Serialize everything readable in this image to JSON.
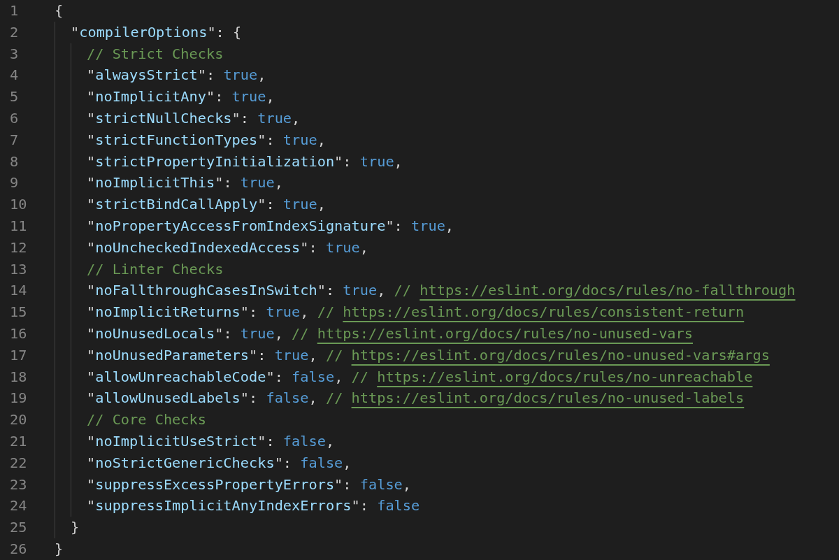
{
  "editor": {
    "lines": [
      {
        "number": "1",
        "tokens": [
          {
            "kind": "punct",
            "text": "{"
          }
        ],
        "children": [
          {
            "number": "2",
            "tokens": [
              {
                "kind": "key",
                "text": "\"compilerOptions\""
              },
              {
                "kind": "punct",
                "text": ": {"
              }
            ],
            "children": [
              {
                "number": "3",
                "tokens": [
                  {
                    "kind": "comment",
                    "text": "// Strict Checks"
                  }
                ]
              },
              {
                "number": "4",
                "tokens": [
                  {
                    "kind": "key",
                    "text": "\"alwaysStrict\""
                  },
                  {
                    "kind": "punct",
                    "text": ": "
                  },
                  {
                    "kind": "bool",
                    "text": "true"
                  },
                  {
                    "kind": "punct",
                    "text": ","
                  }
                ]
              },
              {
                "number": "5",
                "tokens": [
                  {
                    "kind": "key",
                    "text": "\"noImplicitAny\""
                  },
                  {
                    "kind": "punct",
                    "text": ": "
                  },
                  {
                    "kind": "bool",
                    "text": "true"
                  },
                  {
                    "kind": "punct",
                    "text": ","
                  }
                ]
              },
              {
                "number": "6",
                "tokens": [
                  {
                    "kind": "key",
                    "text": "\"strictNullChecks\""
                  },
                  {
                    "kind": "punct",
                    "text": ": "
                  },
                  {
                    "kind": "bool",
                    "text": "true"
                  },
                  {
                    "kind": "punct",
                    "text": ","
                  }
                ]
              },
              {
                "number": "7",
                "tokens": [
                  {
                    "kind": "key",
                    "text": "\"strictFunctionTypes\""
                  },
                  {
                    "kind": "punct",
                    "text": ": "
                  },
                  {
                    "kind": "bool",
                    "text": "true"
                  },
                  {
                    "kind": "punct",
                    "text": ","
                  }
                ]
              },
              {
                "number": "8",
                "tokens": [
                  {
                    "kind": "key",
                    "text": "\"strictPropertyInitialization\""
                  },
                  {
                    "kind": "punct",
                    "text": ": "
                  },
                  {
                    "kind": "bool",
                    "text": "true"
                  },
                  {
                    "kind": "punct",
                    "text": ","
                  }
                ]
              },
              {
                "number": "9",
                "tokens": [
                  {
                    "kind": "key",
                    "text": "\"noImplicitThis\""
                  },
                  {
                    "kind": "punct",
                    "text": ": "
                  },
                  {
                    "kind": "bool",
                    "text": "true"
                  },
                  {
                    "kind": "punct",
                    "text": ","
                  }
                ]
              },
              {
                "number": "10",
                "tokens": [
                  {
                    "kind": "key",
                    "text": "\"strictBindCallApply\""
                  },
                  {
                    "kind": "punct",
                    "text": ": "
                  },
                  {
                    "kind": "bool",
                    "text": "true"
                  },
                  {
                    "kind": "punct",
                    "text": ","
                  }
                ]
              },
              {
                "number": "11",
                "tokens": [
                  {
                    "kind": "key",
                    "text": "\"noPropertyAccessFromIndexSignature\""
                  },
                  {
                    "kind": "punct",
                    "text": ": "
                  },
                  {
                    "kind": "bool",
                    "text": "true"
                  },
                  {
                    "kind": "punct",
                    "text": ","
                  }
                ]
              },
              {
                "number": "12",
                "tokens": [
                  {
                    "kind": "key",
                    "text": "\"noUncheckedIndexedAccess\""
                  },
                  {
                    "kind": "punct",
                    "text": ": "
                  },
                  {
                    "kind": "bool",
                    "text": "true"
                  },
                  {
                    "kind": "punct",
                    "text": ","
                  }
                ]
              },
              {
                "number": "13",
                "tokens": [
                  {
                    "kind": "comment",
                    "text": "// Linter Checks"
                  }
                ]
              },
              {
                "number": "14",
                "tokens": [
                  {
                    "kind": "key",
                    "text": "\"noFallthroughCasesInSwitch\""
                  },
                  {
                    "kind": "punct",
                    "text": ": "
                  },
                  {
                    "kind": "bool",
                    "text": "true"
                  },
                  {
                    "kind": "punct",
                    "text": ", "
                  },
                  {
                    "kind": "comment",
                    "text": "// "
                  },
                  {
                    "kind": "link",
                    "text": "https://eslint.org/docs/rules/no-fallthrough"
                  }
                ]
              },
              {
                "number": "15",
                "tokens": [
                  {
                    "kind": "key",
                    "text": "\"noImplicitReturns\""
                  },
                  {
                    "kind": "punct",
                    "text": ": "
                  },
                  {
                    "kind": "bool",
                    "text": "true"
                  },
                  {
                    "kind": "punct",
                    "text": ", "
                  },
                  {
                    "kind": "comment",
                    "text": "// "
                  },
                  {
                    "kind": "link",
                    "text": "https://eslint.org/docs/rules/consistent-return"
                  }
                ]
              },
              {
                "number": "16",
                "tokens": [
                  {
                    "kind": "key",
                    "text": "\"noUnusedLocals\""
                  },
                  {
                    "kind": "punct",
                    "text": ": "
                  },
                  {
                    "kind": "bool",
                    "text": "true"
                  },
                  {
                    "kind": "punct",
                    "text": ", "
                  },
                  {
                    "kind": "comment",
                    "text": "// "
                  },
                  {
                    "kind": "link",
                    "text": "https://eslint.org/docs/rules/no-unused-vars"
                  }
                ]
              },
              {
                "number": "17",
                "tokens": [
                  {
                    "kind": "key",
                    "text": "\"noUnusedParameters\""
                  },
                  {
                    "kind": "punct",
                    "text": ": "
                  },
                  {
                    "kind": "bool",
                    "text": "true"
                  },
                  {
                    "kind": "punct",
                    "text": ", "
                  },
                  {
                    "kind": "comment",
                    "text": "// "
                  },
                  {
                    "kind": "link",
                    "text": "https://eslint.org/docs/rules/no-unused-vars#args"
                  }
                ]
              },
              {
                "number": "18",
                "tokens": [
                  {
                    "kind": "key",
                    "text": "\"allowUnreachableCode\""
                  },
                  {
                    "kind": "punct",
                    "text": ": "
                  },
                  {
                    "kind": "bool",
                    "text": "false"
                  },
                  {
                    "kind": "punct",
                    "text": ", "
                  },
                  {
                    "kind": "comment",
                    "text": "// "
                  },
                  {
                    "kind": "link",
                    "text": "https://eslint.org/docs/rules/no-unreachable"
                  }
                ]
              },
              {
                "number": "19",
                "tokens": [
                  {
                    "kind": "key",
                    "text": "\"allowUnusedLabels\""
                  },
                  {
                    "kind": "punct",
                    "text": ": "
                  },
                  {
                    "kind": "bool",
                    "text": "false"
                  },
                  {
                    "kind": "punct",
                    "text": ", "
                  },
                  {
                    "kind": "comment",
                    "text": "// "
                  },
                  {
                    "kind": "link",
                    "text": "https://eslint.org/docs/rules/no-unused-labels"
                  }
                ]
              },
              {
                "number": "20",
                "tokens": [
                  {
                    "kind": "comment",
                    "text": "// Core Checks"
                  }
                ]
              },
              {
                "number": "21",
                "tokens": [
                  {
                    "kind": "key",
                    "text": "\"noImplicitUseStrict\""
                  },
                  {
                    "kind": "punct",
                    "text": ": "
                  },
                  {
                    "kind": "bool",
                    "text": "false"
                  },
                  {
                    "kind": "punct",
                    "text": ","
                  }
                ]
              },
              {
                "number": "22",
                "tokens": [
                  {
                    "kind": "key",
                    "text": "\"noStrictGenericChecks\""
                  },
                  {
                    "kind": "punct",
                    "text": ": "
                  },
                  {
                    "kind": "bool",
                    "text": "false"
                  },
                  {
                    "kind": "punct",
                    "text": ","
                  }
                ]
              },
              {
                "number": "23",
                "tokens": [
                  {
                    "kind": "key",
                    "text": "\"suppressExcessPropertyErrors\""
                  },
                  {
                    "kind": "punct",
                    "text": ": "
                  },
                  {
                    "kind": "bool",
                    "text": "false"
                  },
                  {
                    "kind": "punct",
                    "text": ","
                  }
                ]
              },
              {
                "number": "24",
                "tokens": [
                  {
                    "kind": "key",
                    "text": "\"suppressImplicitAnyIndexErrors\""
                  },
                  {
                    "kind": "punct",
                    "text": ": "
                  },
                  {
                    "kind": "bool",
                    "text": "false"
                  }
                ]
              }
            ]
          },
          {
            "number": "25",
            "tokens": [
              {
                "kind": "punct",
                "text": "}"
              }
            ]
          }
        ]
      },
      {
        "number": "26",
        "tokens": [
          {
            "kind": "punct",
            "text": "}"
          }
        ]
      }
    ]
  }
}
